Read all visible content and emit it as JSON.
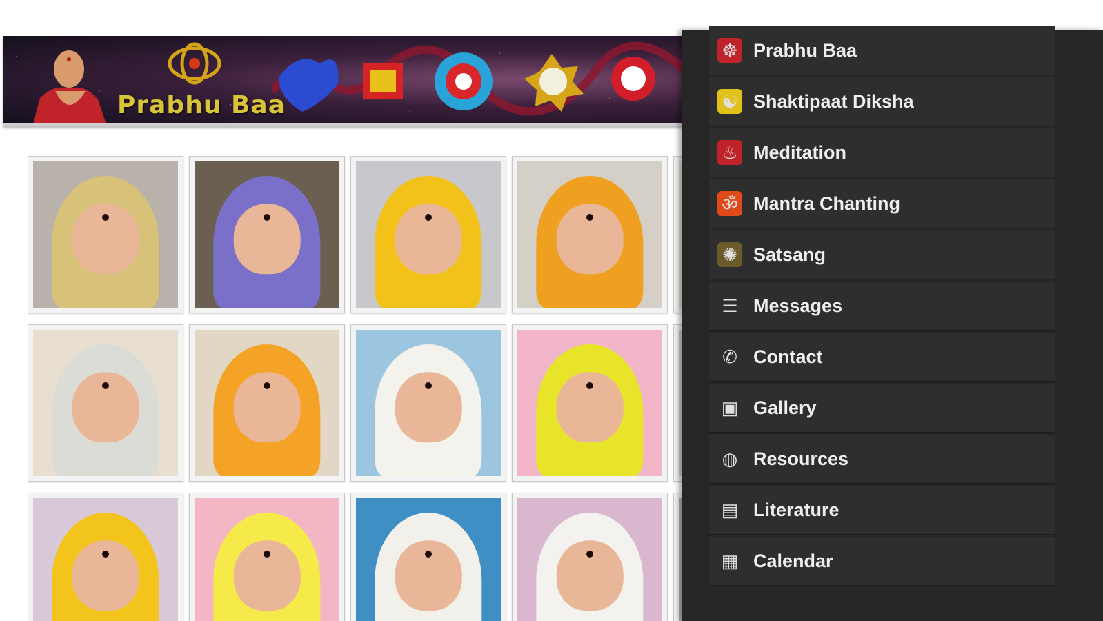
{
  "banner": {
    "title": "Prabhu Baa"
  },
  "menu": {
    "items": [
      {
        "label": "Prabhu Baa",
        "icon": "guru-portrait-icon"
      },
      {
        "label": "Shaktipaat Diksha",
        "icon": "meditating-figure-icon"
      },
      {
        "label": "Meditation",
        "icon": "meditation-figure-icon"
      },
      {
        "label": "Mantra Chanting",
        "icon": "om-symbol-icon"
      },
      {
        "label": "Satsang",
        "icon": "satsang-figure-icon"
      },
      {
        "label": "Messages",
        "icon": "list-icon"
      },
      {
        "label": "Contact",
        "icon": "phone-icon"
      },
      {
        "label": "Gallery",
        "icon": "image-icon"
      },
      {
        "label": "Resources",
        "icon": "globe-icon"
      },
      {
        "label": "Literature",
        "icon": "book-icon"
      },
      {
        "label": "Calendar",
        "icon": "calendar-icon"
      }
    ]
  },
  "gallery": {
    "photos": [
      {
        "veil": "#d8c27a",
        "bg": "#b8b2aa"
      },
      {
        "veil": "#7a6fc9",
        "bg": "#6b5f52"
      },
      {
        "veil": "#f2c21a",
        "bg": "#c8c8cc"
      },
      {
        "veil": "#f0a020",
        "bg": "#d4cfc7"
      },
      {
        "veil": "#dcdcd6",
        "bg": "#e8dfd0"
      },
      {
        "veil": "#f5a326",
        "bg": "#e2d7c5"
      },
      {
        "veil": "#f4f2ec",
        "bg": "#9cc6e0"
      },
      {
        "veil": "#e8e42a",
        "bg": "#f3b6c9"
      },
      {
        "veil": "#f2c41c",
        "bg": "#d9c8d8"
      },
      {
        "veil": "#f5ea4a",
        "bg": "#f2b7c3"
      },
      {
        "veil": "#f2f0ea",
        "bg": "#3f8fc4"
      },
      {
        "veil": "#f4f2ee",
        "bg": "#d9b8cf"
      }
    ]
  }
}
